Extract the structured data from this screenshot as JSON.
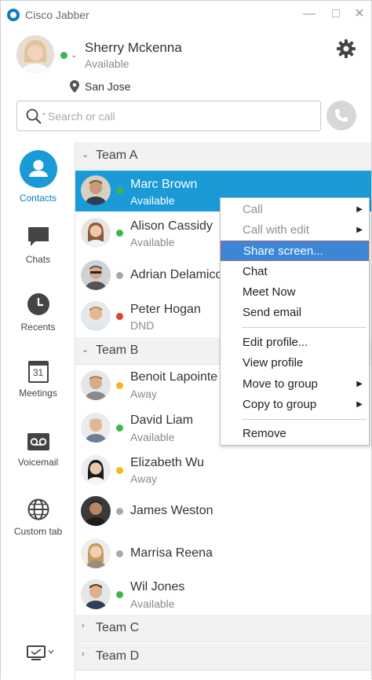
{
  "window": {
    "title": "Cisco Jabber"
  },
  "profile": {
    "name": "Sherry Mckenna",
    "status": "Available",
    "location": "San Jose"
  },
  "search": {
    "placeholder": "Search or call"
  },
  "nav": {
    "items": [
      {
        "label": "Contacts",
        "icon": "contacts-icon"
      },
      {
        "label": "Chats",
        "icon": "chats-icon"
      },
      {
        "label": "Recents",
        "icon": "recents-icon"
      },
      {
        "label": "Meetings",
        "icon": "meetings-icon",
        "badge": "31"
      },
      {
        "label": "Voicemail",
        "icon": "voicemail-icon"
      },
      {
        "label": "Custom tab",
        "icon": "globe-icon"
      }
    ]
  },
  "groups": [
    {
      "name": "Team A"
    },
    {
      "name": "Team B"
    },
    {
      "name": "Team C"
    },
    {
      "name": "Team D"
    }
  ],
  "contacts": [
    {
      "name": "Marc Brown",
      "status": "Available"
    },
    {
      "name": "Alison Cassidy",
      "status": "Available"
    },
    {
      "name": "Adrian Delamico",
      "status": ""
    },
    {
      "name": "Peter Hogan",
      "status": "DND"
    },
    {
      "name": "Benoit Lapointe",
      "status": "Away"
    },
    {
      "name": "David Liam",
      "status": "Available"
    },
    {
      "name": "Elizabeth Wu",
      "status": "Away"
    },
    {
      "name": "James Weston",
      "status": ""
    },
    {
      "name": "Marrisa Reena",
      "status": ""
    },
    {
      "name": "Wil Jones",
      "status": "Available"
    }
  ],
  "context_menu": {
    "items": [
      {
        "label": "Call"
      },
      {
        "label": "Call with edit"
      },
      {
        "label": "Share screen..."
      },
      {
        "label": "Chat"
      },
      {
        "label": "Meet Now"
      },
      {
        "label": "Send email"
      },
      {
        "label": "Edit profile..."
      },
      {
        "label": "View profile"
      },
      {
        "label": "Move to group"
      },
      {
        "label": "Copy to group"
      },
      {
        "label": "Remove"
      }
    ]
  },
  "colors": {
    "accent": "#1a9ad6",
    "available": "#3fb54a",
    "away": "#f2b81f",
    "dnd": "#e2402f",
    "offline": "#a8a8a8"
  }
}
